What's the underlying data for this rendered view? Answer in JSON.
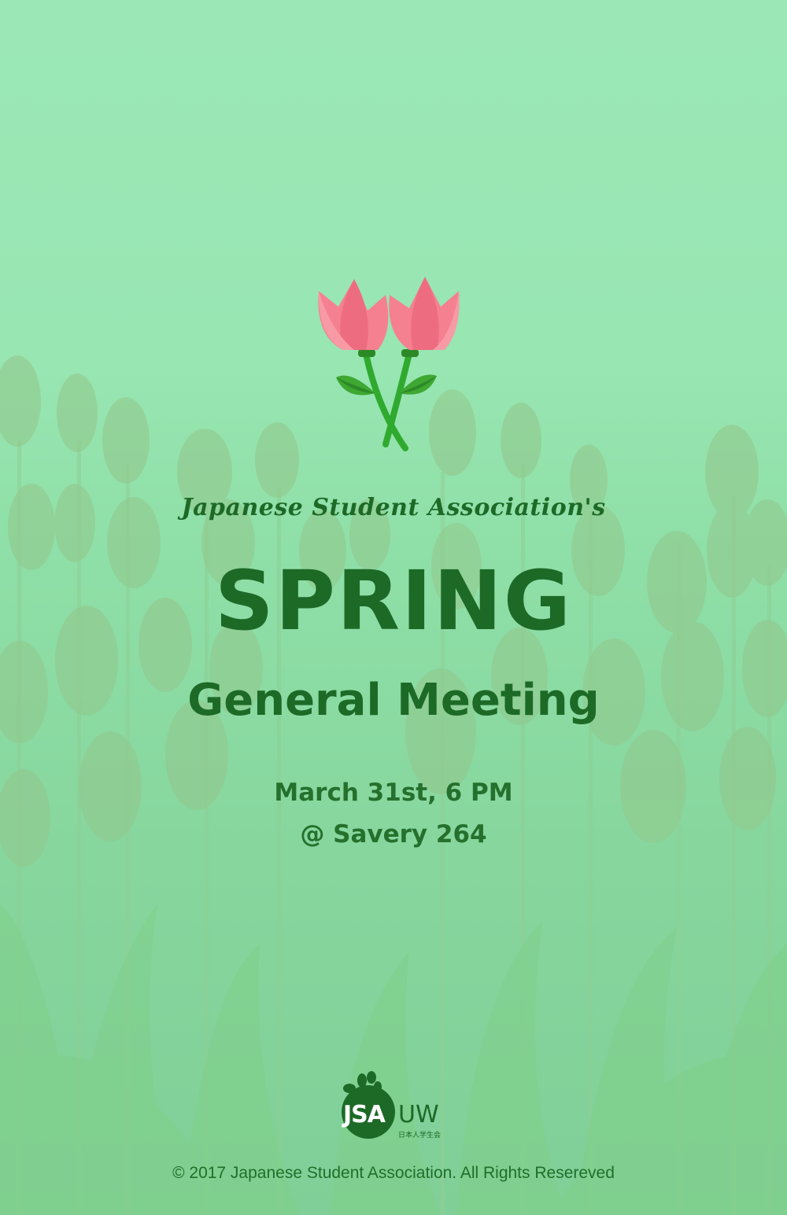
{
  "poster": {
    "tagline": "Japanese Student Association's",
    "headline": "SPRING",
    "subhead": "General Meeting",
    "date_time": "March 31st, 6 PM",
    "venue": "@ Savery 264",
    "copyright": "© 2017 Japanese Student Association. All Rights Resereved"
  },
  "logo": {
    "letters": "JSA",
    "suffix": "UW",
    "kanji": "日本人学生会"
  },
  "colors": {
    "background": "#98e6b2",
    "text_green": "#1d6a27",
    "tulip_pink": "#f47f8f",
    "leaf_green": "#3aa535"
  }
}
